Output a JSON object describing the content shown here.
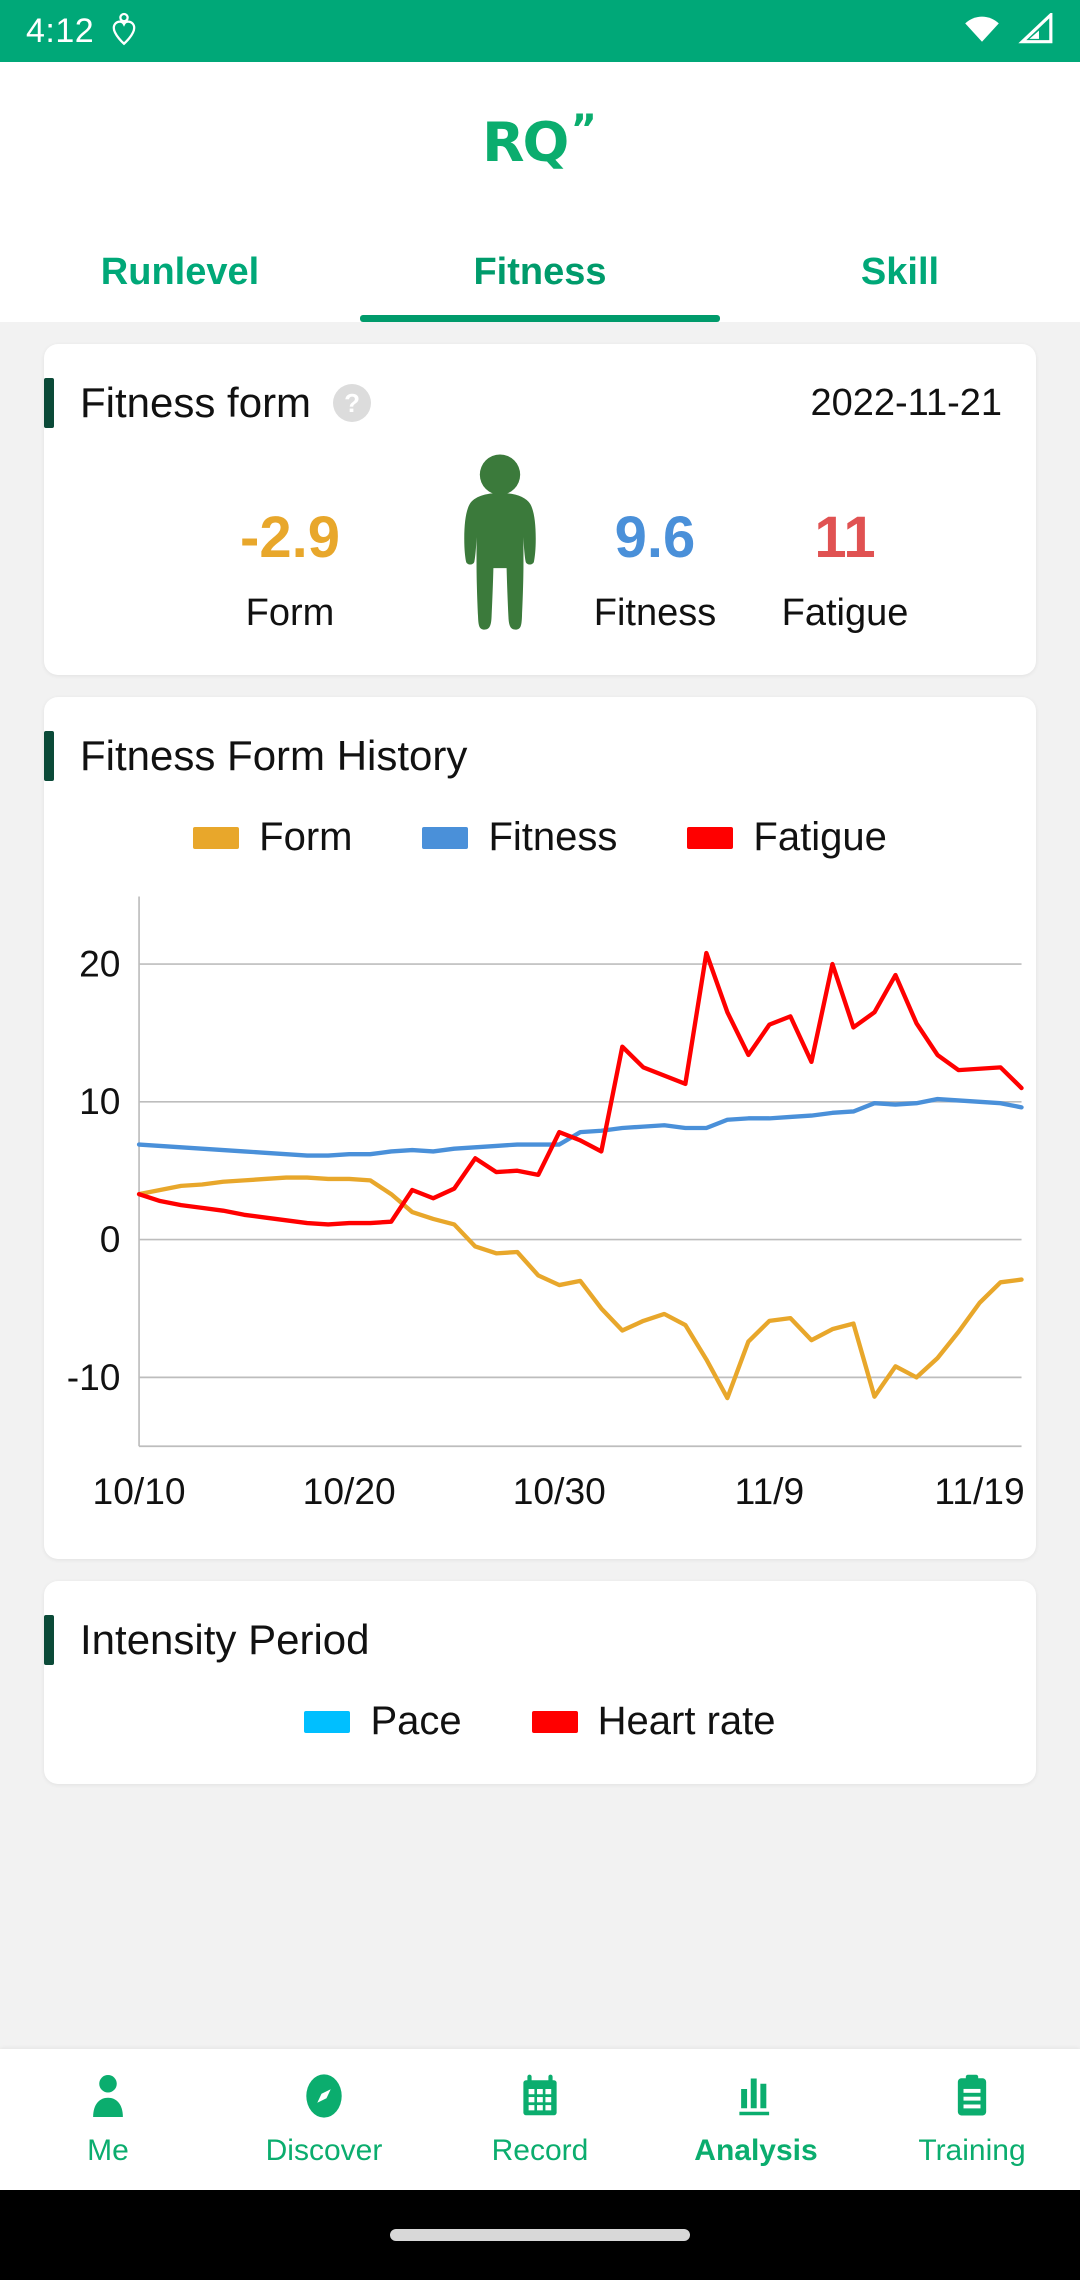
{
  "theme": {
    "brand_green": "#00A878",
    "logo_green": "#0BAD6E",
    "accent_bar": "#0B4A38",
    "form_color": "#E8A72B",
    "fitness_color": "#4A90D9",
    "fatigue_color": "#FF0000",
    "pace_color": "#00BFFF",
    "heart_rate_color": "#FF0000",
    "person_green": "#3B7A3B"
  },
  "statusbar": {
    "time": "4:12",
    "left_icon": "heart-location-icon",
    "wifi_icon": "wifi-icon",
    "signal_icon": "signal-icon"
  },
  "header": {
    "logo_text": "RQ",
    "logo_mark": "”"
  },
  "tabs": [
    {
      "label": "Runlevel",
      "active": false
    },
    {
      "label": "Fitness",
      "active": true
    },
    {
      "label": "Skill",
      "active": false
    }
  ],
  "fitness_form_card": {
    "title": "Fitness form",
    "help_glyph": "?",
    "date": "2022-11-21",
    "stats": [
      {
        "name": "form",
        "value": "-2.9",
        "label": "Form"
      },
      {
        "name": "fitness",
        "value": "9.6",
        "label": "Fitness"
      },
      {
        "name": "fatigue",
        "value": "11",
        "label": "Fatigue"
      }
    ],
    "figure_icon": "person-standing-icon"
  },
  "history_card": {
    "title": "Fitness Form History",
    "legend": [
      {
        "label": "Form",
        "color": "#E8A72B"
      },
      {
        "label": "Fitness",
        "color": "#4A90D9"
      },
      {
        "label": "Fatigue",
        "color": "#FF0000"
      }
    ]
  },
  "intensity_card": {
    "title": "Intensity Period",
    "legend": [
      {
        "label": "Pace",
        "color": "#00BFFF"
      },
      {
        "label": "Heart rate",
        "color": "#FF0000"
      }
    ]
  },
  "bottom_nav": [
    {
      "label": "Me",
      "icon": "person-icon",
      "active": false
    },
    {
      "label": "Discover",
      "icon": "compass-icon",
      "active": false
    },
    {
      "label": "Record",
      "icon": "calendar-icon",
      "active": false
    },
    {
      "label": "Analysis",
      "icon": "bar-chart-icon",
      "active": true
    },
    {
      "label": "Training",
      "icon": "clipboard-icon",
      "active": false
    }
  ],
  "chart_data": {
    "type": "line",
    "title": "Fitness Form History",
    "xlabel": "",
    "ylabel": "",
    "ylim": [
      -15,
      24
    ],
    "yticks": [
      20,
      10,
      0,
      -10
    ],
    "ytick_labels": [
      "20",
      "10",
      "0",
      "-10"
    ],
    "grid": true,
    "legend_position": "top",
    "xtick_labels": [
      "10/10",
      "10/20",
      "10/30",
      "11/9",
      "11/19"
    ],
    "xtick_indices": [
      0,
      10,
      20,
      30,
      40
    ],
    "x": [
      "10/10",
      "10/11",
      "10/12",
      "10/13",
      "10/14",
      "10/15",
      "10/16",
      "10/17",
      "10/18",
      "10/19",
      "10/20",
      "10/21",
      "10/22",
      "10/23",
      "10/24",
      "10/25",
      "10/26",
      "10/27",
      "10/28",
      "10/29",
      "10/30",
      "10/31",
      "11/1",
      "11/2",
      "11/3",
      "11/4",
      "11/5",
      "11/6",
      "11/7",
      "11/8",
      "11/9",
      "11/10",
      "11/11",
      "11/12",
      "11/13",
      "11/14",
      "11/15",
      "11/16",
      "11/17",
      "11/18",
      "11/19",
      "11/20",
      "11/21"
    ],
    "series": [
      {
        "name": "Form",
        "color": "#E8A72B",
        "values": [
          3.3,
          3.6,
          3.9,
          4.0,
          4.2,
          4.3,
          4.4,
          4.5,
          4.5,
          4.4,
          4.4,
          4.3,
          3.3,
          2.0,
          1.5,
          1.1,
          -0.5,
          -1.0,
          -0.9,
          -2.6,
          -3.3,
          -3.0,
          -5.0,
          -6.6,
          -5.9,
          -5.4,
          -6.2,
          -8.7,
          -11.5,
          -7.4,
          -5.9,
          -5.7,
          -7.3,
          -6.5,
          -6.1,
          -11.4,
          -9.2,
          -10.0,
          -8.6,
          -6.7,
          -4.6,
          -3.1,
          -2.9
        ]
      },
      {
        "name": "Fitness",
        "color": "#4A90D9",
        "values": [
          6.9,
          6.8,
          6.7,
          6.6,
          6.5,
          6.4,
          6.3,
          6.2,
          6.1,
          6.1,
          6.2,
          6.2,
          6.4,
          6.5,
          6.4,
          6.6,
          6.7,
          6.8,
          6.9,
          6.9,
          6.9,
          7.8,
          7.9,
          8.1,
          8.2,
          8.3,
          8.1,
          8.1,
          8.7,
          8.8,
          8.8,
          8.9,
          9.0,
          9.2,
          9.3,
          9.9,
          9.8,
          9.9,
          10.2,
          10.1,
          10.0,
          9.9,
          9.6
        ]
      },
      {
        "name": "Fatigue",
        "color": "#FF0000",
        "values": [
          3.3,
          2.8,
          2.5,
          2.3,
          2.1,
          1.8,
          1.6,
          1.4,
          1.2,
          1.1,
          1.2,
          1.2,
          1.3,
          3.6,
          3.0,
          3.7,
          5.9,
          4.9,
          5.0,
          4.7,
          7.8,
          7.2,
          6.4,
          14.0,
          12.5,
          11.9,
          11.3,
          20.8,
          16.5,
          13.4,
          15.6,
          16.2,
          12.9,
          20.0,
          15.4,
          16.5,
          19.2,
          15.7,
          13.4,
          12.3,
          12.4,
          12.5,
          11.0
        ]
      }
    ]
  }
}
